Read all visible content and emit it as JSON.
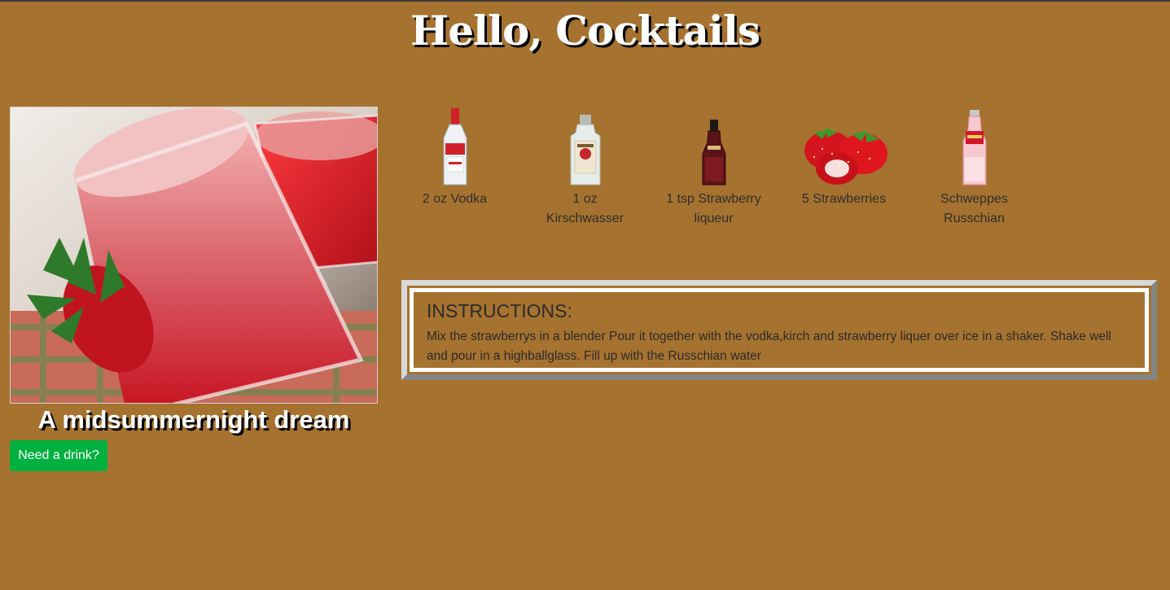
{
  "header": {
    "title": "Hello, Cocktails"
  },
  "drink": {
    "name": "A midsummernight dream",
    "button_label": "Need a drink?"
  },
  "ingredients": [
    {
      "label": "2 oz Vodka",
      "icon": "vodka-bottle-icon"
    },
    {
      "label": "1 oz Kirschwasser",
      "icon": "kirschwasser-bottle-icon"
    },
    {
      "label": "1 tsp Strawberry liqueur",
      "icon": "liqueur-bottle-icon"
    },
    {
      "label": "5 Strawberries",
      "icon": "strawberries-icon"
    },
    {
      "label": "Schweppes Russchian",
      "icon": "schweppes-bottle-icon"
    }
  ],
  "instructions": {
    "heading": "INSTRUCTIONS:",
    "text": "Mix the strawberrys in a blender Pour it together with the vodka,kirch and strawberry liquer over ice in a shaker. Shake well and pour in a highballglass. Fill up with the Russchian water"
  },
  "colors": {
    "background": "#a6722f",
    "button": "#00b140",
    "title_text": "#ffffff"
  }
}
